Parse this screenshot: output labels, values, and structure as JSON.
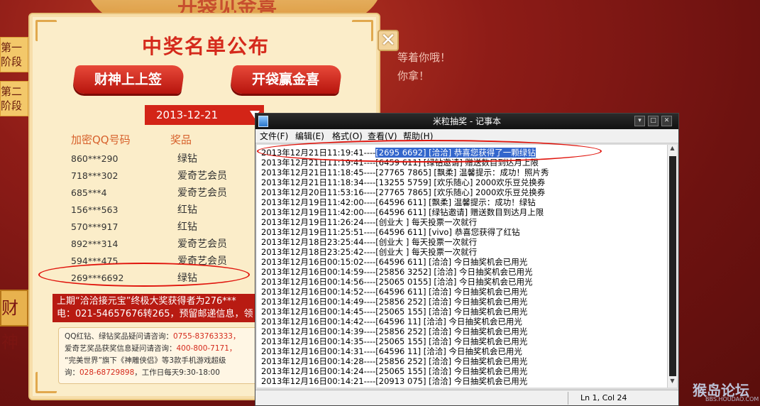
{
  "background": {
    "banner_text": "开袋见金喜",
    "side_tabs": [
      {
        "line1": "第一",
        "line2": "阶段"
      },
      {
        "line1": "第二",
        "line2": "阶段"
      }
    ],
    "side_gold_text": "财神",
    "fragments": [
      "等着你哦！",
      "你拿！"
    ]
  },
  "panel": {
    "title": "中奖名单公布",
    "buttons": [
      "财神上上签",
      "开袋赢金喜"
    ],
    "date": "2013-12-21",
    "col_qq": "加密QQ号码",
    "col_prize": "奖品",
    "winners": [
      {
        "qq": "860***290",
        "prize": "绿钻"
      },
      {
        "qq": "718***302",
        "prize": "爱奇艺会员"
      },
      {
        "qq": "685***4",
        "prize": "爱奇艺会员"
      },
      {
        "qq": "156***563",
        "prize": "红钻"
      },
      {
        "qq": "570***917",
        "prize": "红钻"
      },
      {
        "qq": "892***314",
        "prize": "爱奇艺会员"
      },
      {
        "qq": "594***475",
        "prize": "爱奇艺会员"
      },
      {
        "qq": "269***6692",
        "prize": "绿钻"
      }
    ],
    "notice_line1": "上期“洽洽接元宝”终极大奖获得者为276***",
    "notice_line2": "电：021-54657676转265，预留邮递信息，领",
    "info_lines": [
      {
        "label": "QQ红钻、绿钻奖品疑问请咨询：",
        "value": "0755-83763333，"
      },
      {
        "label": "爱奇艺奖品获奖信息疑问请咨询：",
        "value": "400-800-7171，"
      },
      {
        "label": "“完美世界”旗下《神雕侠侣》等3款手机游戏超级",
        "value": ""
      },
      {
        "label": "询：",
        "value": "028-68729898",
        "suffix": "，工作日每天9:30-18:00"
      }
    ],
    "close_glyph": "✕"
  },
  "notepad": {
    "title": "米粒抽奖 - 记事本",
    "menus": [
      "文件(F)",
      "编辑(E)",
      "格式(O)",
      "查看(V)",
      "帮助(H)"
    ],
    "lines": [
      "2013年12月21日11:19:41----[2695   6692] [洽洽] 恭喜您获得了一颗绿钻",
      "2013年12月21日11:19:41----[6459   611] [绿钻邀请] 赠送数目到达月上限",
      "2013年12月21日11:18:45----[27765   7865] [飘柔] 温馨提示：成功！照片秀",
      "2013年12月21日11:18:34----[13255   5759] [欢乐随心] 2000欢乐豆兑换券",
      "2013年12月20日11:53:16----[27765   7865] [欢乐随心] 2000欢乐豆兑换券",
      "2013年12月19日11:42:00----[64596   611] [飘柔] 温馨提示：成功！绿钻",
      "2013年12月19日11:42:00----[64596   611] [绿钻邀请] 赠送数目到达月上限",
      "2013年12月19日11:26:24----[创业大   ] 每天投票一次就行",
      "2013年12月19日11:25:51----[64596   611] [vivo] 恭喜您获得了红钻",
      "2013年12月18日23:25:44----[创业大   ] 每天投票一次就行",
      "2013年12月18日23:25:42----[创业大   ] 每天投票一次就行",
      "2013年12月16日00:15:02----[64596   611] [洽洽] 今日抽奖机会已用光",
      "2013年12月16日00:14:59----[25856   3252] [洽洽] 今日抽奖机会已用光",
      "2013年12月16日00:14:56----[25065   0155] [洽洽] 今日抽奖机会已用光",
      "2013年12月16日00:14:52----[64596   611] [洽洽] 今日抽奖机会已用光",
      "2013年12月16日00:14:49----[25856   252] [洽洽] 今日抽奖机会已用光",
      "2013年12月16日00:14:45----[25065   155] [洽洽] 今日抽奖机会已用光",
      "2013年12月16日00:14:42----[64596   11] [洽洽] 今日抽奖机会已用光",
      "2013年12月16日00:14:39----[25856   252] [洽洽] 今日抽奖机会已用光",
      "2013年12月16日00:14:35----[25065   155] [洽洽] 今日抽奖机会已用光",
      "2013年12月16日00:14:31----[64596   11] [洽洽] 今日抽奖机会已用光",
      "2013年12月16日00:14:28----[25856   252] [洽洽] 今日抽奖机会已用光",
      "2013年12月16日00:14:24----[25065   155] [洽洽] 今日抽奖机会已用光",
      "2013年12月16日00:14:21----[20913   075] [洽洽] 今日抽奖机会已用光"
    ],
    "selected_prefix": "2013年12月21日11:19:41----",
    "selected_text": "[2695   6692] [洽洽] 恭喜您获得了一颗绿钻",
    "status": "Ln 1, Col 24"
  },
  "watermark": {
    "text": "猴岛论坛",
    "sub": "BBS.HOUDAO.COM"
  },
  "colors": {
    "accent_red": "#d52a1c",
    "panel_bg": "#fbedc9",
    "selection": "#3366cc"
  }
}
